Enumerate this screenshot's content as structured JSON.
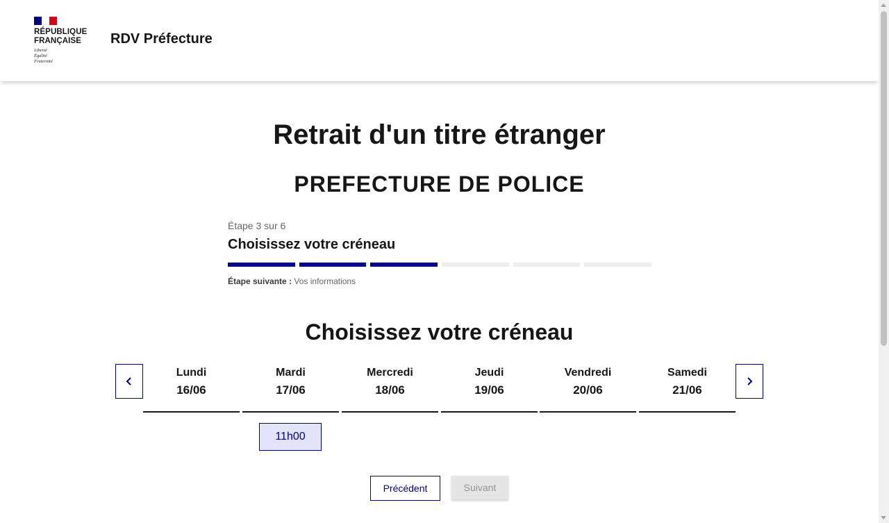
{
  "header": {
    "logo_title": "RÉPUBLIQUE\nFRANÇAISE",
    "logo_motto": "Liberté\nÉgalité\nFraternité",
    "service_name": "RDV Préfecture"
  },
  "main": {
    "page_title": "Retrait d'un titre étranger",
    "org_title": "PREFECTURE DE POLICE",
    "stepper": {
      "count": "Étape 3 sur 6",
      "title": "Choisissez votre créneau",
      "current_step": 3,
      "total_steps": 6,
      "next_label": "Étape suivante :",
      "next_value": "Vos informations"
    },
    "section_title": "Choisissez votre créneau",
    "calendar": {
      "days": [
        {
          "name": "Lundi",
          "date": "16/06"
        },
        {
          "name": "Mardi",
          "date": "17/06"
        },
        {
          "name": "Mercredi",
          "date": "18/06"
        },
        {
          "name": "Jeudi",
          "date": "19/06"
        },
        {
          "name": "Vendredi",
          "date": "20/06"
        },
        {
          "name": "Samedi",
          "date": "21/06"
        }
      ],
      "slot": {
        "day": "Mardi",
        "time": "11h00"
      }
    },
    "buttons": {
      "previous": "Précédent",
      "next": "Suivant"
    }
  },
  "colors": {
    "primary": "#000091",
    "slot_bg": "#e3e3fd",
    "disabled_bg": "#e5e5e5",
    "flag_red": "#e1000f"
  }
}
